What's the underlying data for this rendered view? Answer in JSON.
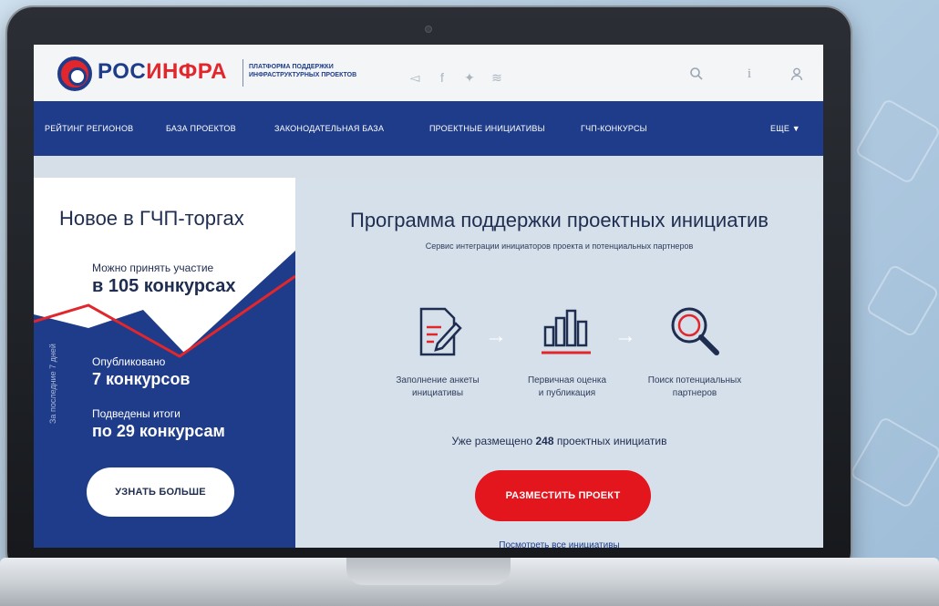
{
  "header": {
    "logo_text_a": "РОС",
    "logo_text_b": "ИНФРА",
    "logo_subtitle_line1": "ПЛАТФОРМА ПОДДЕРЖКИ",
    "logo_subtitle_line2": "ИНФРАСТРУКТУРНЫХ ПРОЕКТОВ",
    "social_icons": [
      "telegram-icon",
      "facebook-icon",
      "twitter-icon",
      "rss-icon"
    ],
    "right_icons": [
      "search-icon",
      "info-icon",
      "user-icon"
    ]
  },
  "nav": {
    "items": [
      "РЕЙТИНГ РЕГИОНОВ",
      "БАЗА ПРОЕКТОВ",
      "ЗАКОНОДАТЕЛЬНАЯ БАЗА",
      "ПРОЕКТНЫЕ ИНИЦИАТИВЫ",
      "ГЧП-КОНКУРСЫ"
    ],
    "more_label": "ЕЩЕ"
  },
  "left": {
    "title": "Новое в ГЧП-торгах",
    "can_join_label": "Можно принять участие",
    "can_join_value": "в 105 конкурсах",
    "period_label": "За последние 7 дней",
    "published_label": "Опубликовано",
    "published_value": "7 конкурсов",
    "results_label": "Подведены итоги",
    "results_value": "по 29 конкурсам",
    "button_label": "УЗНАТЬ БОЛЬШЕ"
  },
  "right": {
    "title": "Программа поддержки проектных инициатив",
    "subtitle": "Сервис интеграции инициаторов проекта и потенциальных партнеров",
    "steps": [
      {
        "line1": "Заполнение анкеты",
        "line2": "инициативы",
        "icon": "form-edit-icon"
      },
      {
        "line1": "Первичная оценка",
        "line2": "и публикация",
        "icon": "bar-chart-icon"
      },
      {
        "line1": "Поиск потенциальных",
        "line2": "партнеров",
        "icon": "magnifier-icon"
      }
    ],
    "posted_prefix": "Уже размещено",
    "posted_count": "248",
    "posted_suffix": "проектных инициатив",
    "button_label": "РАЗМЕСТИТЬ ПРОЕКТ",
    "view_all_label": "Посмотреть все инициативы"
  },
  "colors": {
    "brand_blue": "#1e3c8a",
    "brand_red": "#e1262c",
    "panel_bg": "#d6e0ea"
  }
}
